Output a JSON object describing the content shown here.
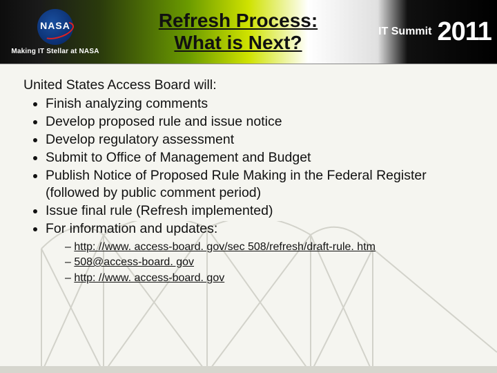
{
  "header": {
    "logo_text": "NASA",
    "tagline": "Making IT Stellar at NASA",
    "title_line1": "Refresh Process:",
    "title_line2": "What is Next?",
    "summit_label1": "IT Summit",
    "summit_year": "2011"
  },
  "content": {
    "intro": "United States Access Board will:",
    "bullets": [
      "Finish analyzing comments",
      "Develop proposed rule and issue notice",
      "Develop regulatory assessment",
      "Submit to Office of Management and Budget",
      "Publish Notice of Proposed Rule Making in the Federal Register (followed by public comment period)",
      "Issue final rule (Refresh implemented)",
      "For information and updates:"
    ],
    "links": [
      "http: //www. access-board. gov/sec 508/refresh/draft-rule. htm",
      "508@access-board. gov",
      "http: //www. access-board. gov"
    ]
  }
}
